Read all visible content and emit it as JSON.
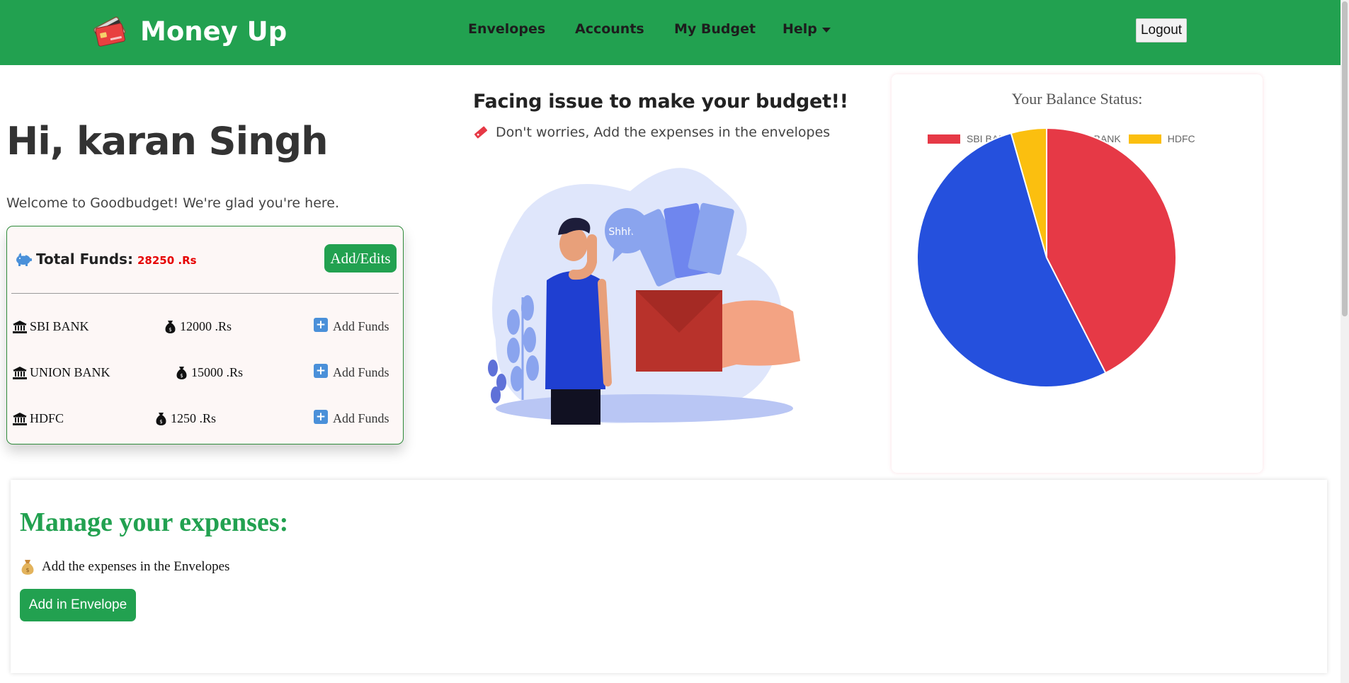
{
  "brand": {
    "name": "Money Up",
    "icon": "credit-card-icon"
  },
  "nav": {
    "envelopes": "Envelopes",
    "accounts": "Accounts",
    "my_budget": "My Budget",
    "help": "Help",
    "logout": "Logout"
  },
  "greeting": {
    "title": "Hi, karan Singh",
    "welcome": "Welcome to Goodbudget! We're glad you're here."
  },
  "funds": {
    "label": "Total Funds:",
    "value": "28250 .Rs",
    "edit_button": "Add/Edits",
    "accounts": [
      {
        "name": "SBI BANK",
        "amount": "12000 .Rs",
        "action": "Add Funds"
      },
      {
        "name": "UNION BANK",
        "amount": "15000 .Rs",
        "action": "Add Funds"
      },
      {
        "name": "HDFC",
        "amount": "1250 .Rs",
        "action": "Add Funds"
      }
    ]
  },
  "promo": {
    "title": "Facing issue to make your budget!!",
    "subtitle": "Don't worries, Add the expenses in the envelopes",
    "bubble_text": "Shhhhh"
  },
  "chart_data": {
    "type": "pie",
    "title": "Your Balance Status:",
    "categories": [
      "SBI BANK",
      "UNION BANK",
      "HDFC"
    ],
    "values": [
      12000,
      15000,
      1250
    ],
    "colors": [
      "#e63946",
      "#2550dd",
      "#fbbf0f"
    ],
    "legend_position": "top"
  },
  "manage": {
    "title": "Manage your expenses:",
    "subtitle": "Add the expenses in the Envelopes",
    "button": "Add in Envelope"
  },
  "colors": {
    "primary_green": "#22a150",
    "funds_value_red": "#e60000",
    "info_blue": "#4a90d9"
  }
}
